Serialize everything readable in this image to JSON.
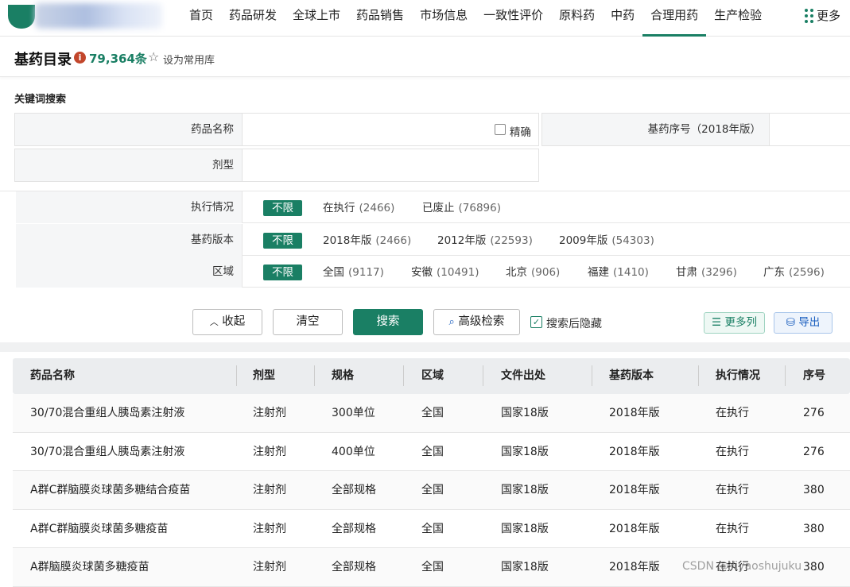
{
  "nav": {
    "items": [
      "首页",
      "药品研发",
      "全球上市",
      "药品销售",
      "市场信息",
      "一致性评价",
      "原料药",
      "中药",
      "合理用药",
      "生产检验"
    ],
    "active_index": 8,
    "more_label": "更多"
  },
  "header": {
    "title": "基药目录",
    "count": "79,364条",
    "fav_label": "设为常用库"
  },
  "search": {
    "section_label": "关键词搜索",
    "drug_name_label": "药品名称",
    "exact_label": "精确",
    "edl_no_label": "基药序号（2018年版）",
    "dosage_label": "剂型"
  },
  "filters": [
    {
      "label": "执行情况",
      "options": [
        {
          "text": "不限",
          "count": "",
          "selected": true
        },
        {
          "text": "在执行",
          "count": "(2466)"
        },
        {
          "text": "已废止",
          "count": "(76896)"
        }
      ]
    },
    {
      "label": "基药版本",
      "options": [
        {
          "text": "不限",
          "count": "",
          "selected": true
        },
        {
          "text": "2018年版",
          "count": "(2466)"
        },
        {
          "text": "2012年版",
          "count": "(22593)"
        },
        {
          "text": "2009年版",
          "count": "(54303)"
        }
      ]
    },
    {
      "label": "区域",
      "options": [
        {
          "text": "不限",
          "count": "",
          "selected": true
        },
        {
          "text": "全国",
          "count": "(9117)"
        },
        {
          "text": "安徽",
          "count": "(10491)"
        },
        {
          "text": "北京",
          "count": "(906)"
        },
        {
          "text": "福建",
          "count": "(1410)"
        },
        {
          "text": "甘肃",
          "count": "(3296)"
        },
        {
          "text": "广东",
          "count": "(2596)"
        }
      ]
    }
  ],
  "actions": {
    "collapse": "收起",
    "clear": "清空",
    "search": "搜索",
    "advanced": "高级检索",
    "hide_after": "搜索后隐藏",
    "more_cols": "更多列",
    "export": "导出"
  },
  "table": {
    "columns": [
      "药品名称",
      "剂型",
      "规格",
      "区域",
      "文件出处",
      "基药版本",
      "执行情况",
      "序号"
    ],
    "rows": [
      [
        "30/70混合重组人胰岛素注射液",
        "注射剂",
        "300单位",
        "全国",
        "国家18版",
        "2018年版",
        "在执行",
        "276"
      ],
      [
        "30/70混合重组人胰岛素注射液",
        "注射剂",
        "400单位",
        "全国",
        "国家18版",
        "2018年版",
        "在执行",
        "276"
      ],
      [
        "A群C群脑膜炎球菌多糖结合疫苗",
        "注射剂",
        "全部规格",
        "全国",
        "国家18版",
        "2018年版",
        "在执行",
        "380"
      ],
      [
        "A群C群脑膜炎球菌多糖疫苗",
        "注射剂",
        "全部规格",
        "全国",
        "国家18版",
        "2018年版",
        "在执行",
        "380"
      ],
      [
        "A群脑膜炎球菌多糖疫苗",
        "注射剂",
        "全部规格",
        "全国",
        "国家18版",
        "2018年版",
        "在执行",
        "380"
      ]
    ]
  },
  "watermark": "CSDN @Yiyaoshujuku",
  "colors": {
    "brand": "#1a7f64",
    "export_blue": "#1b5fbf"
  }
}
